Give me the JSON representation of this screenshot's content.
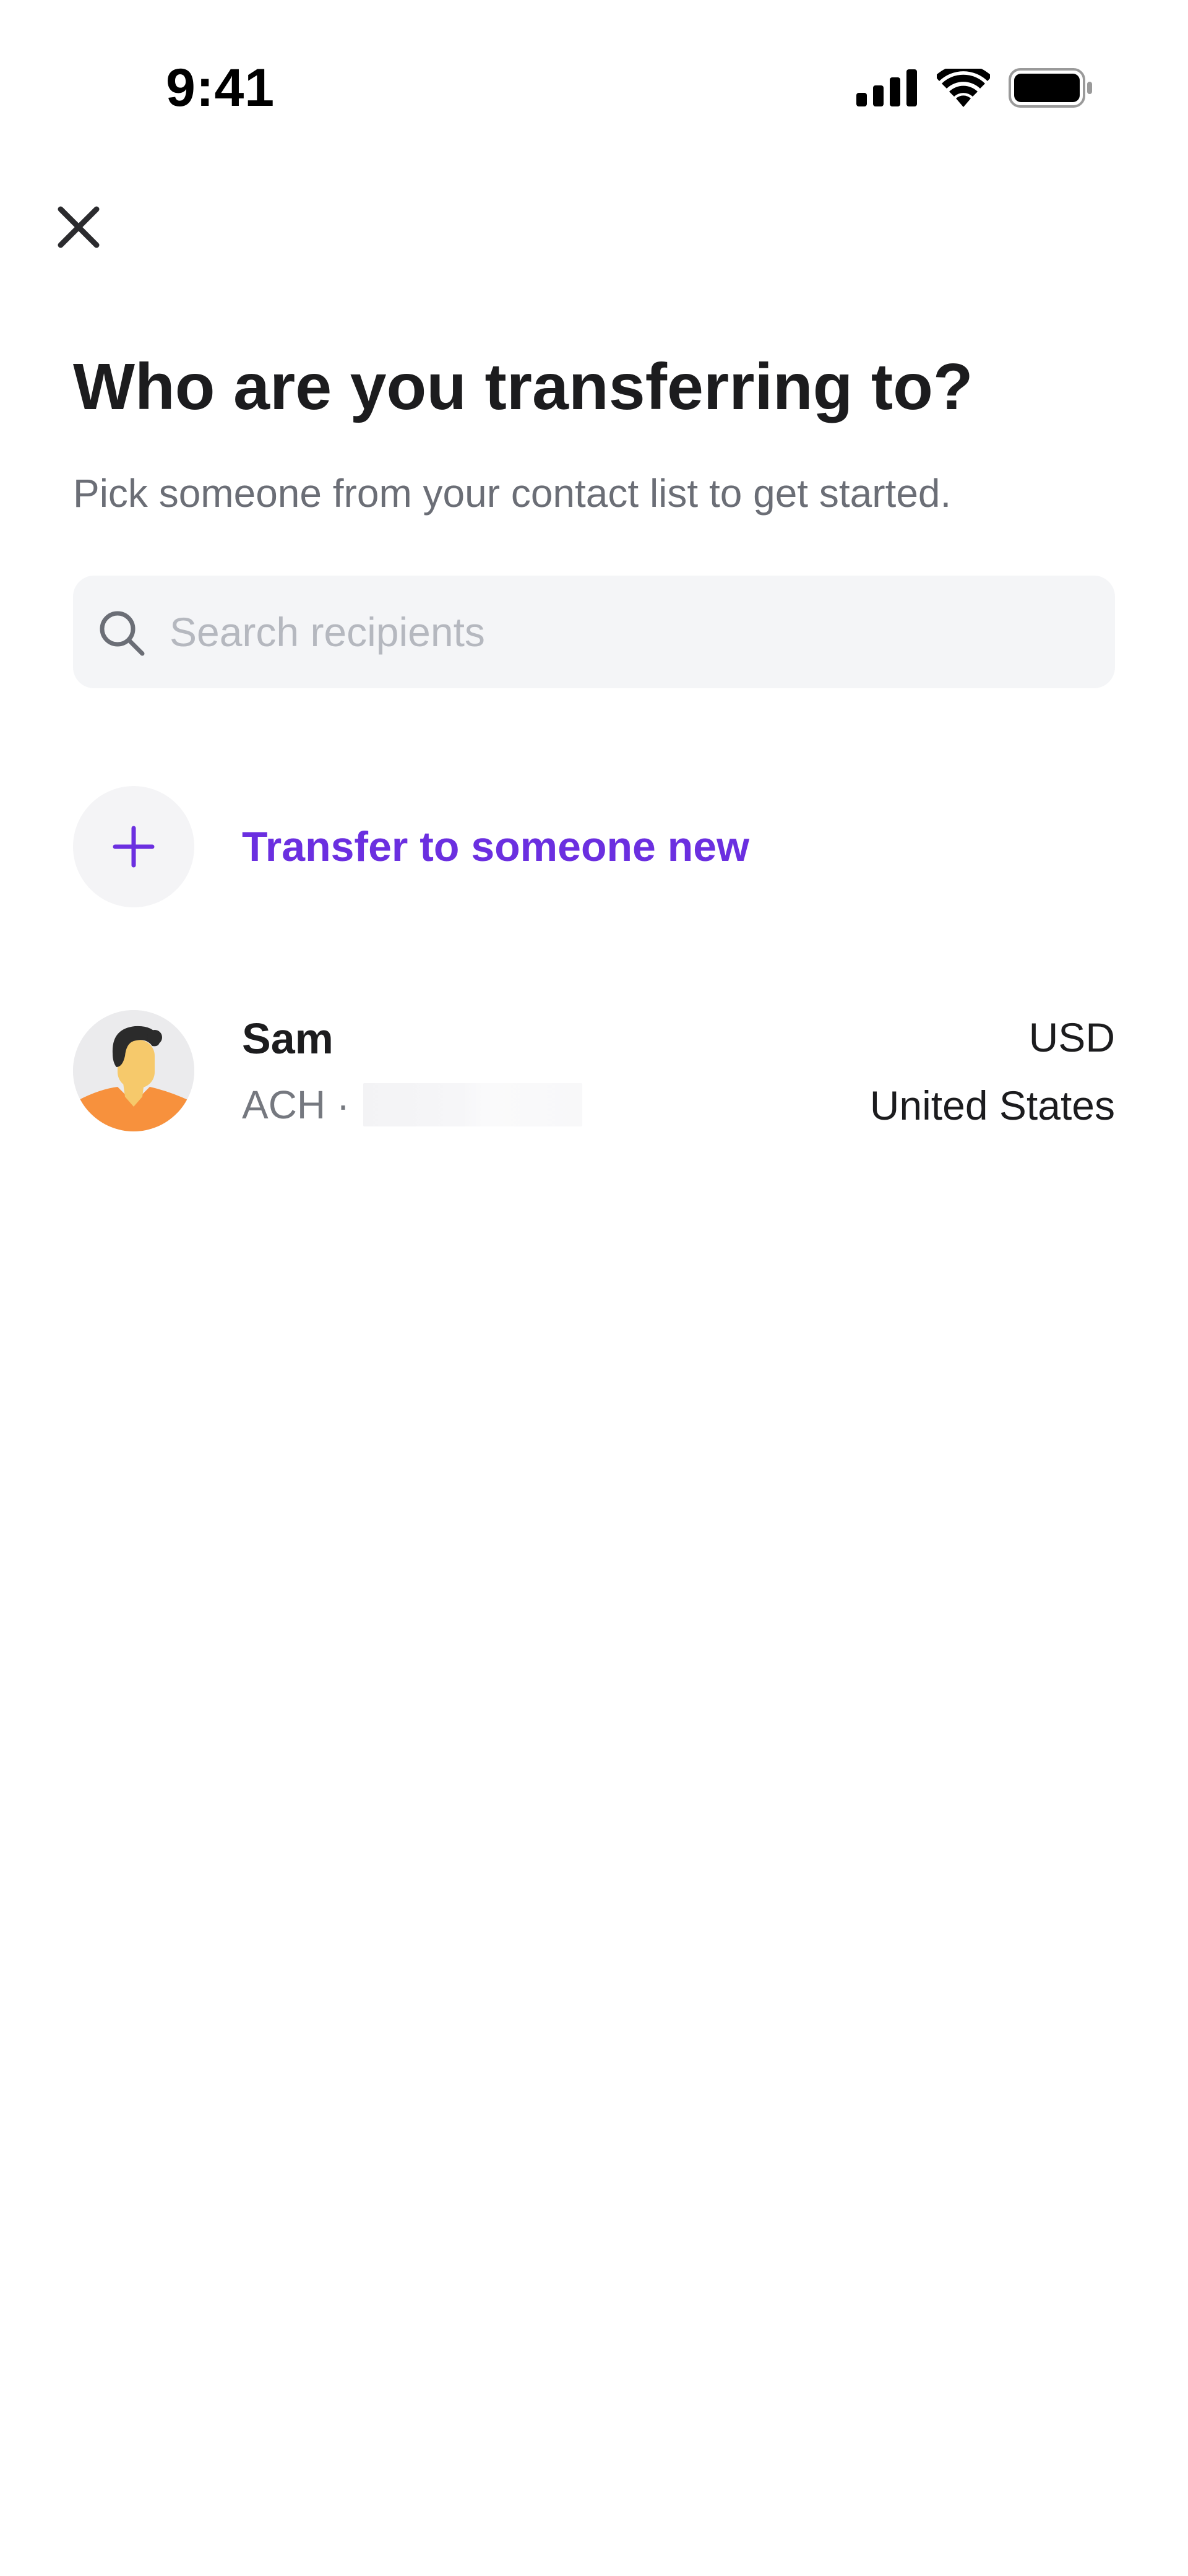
{
  "status_bar": {
    "time": "9:41",
    "icons": [
      "cellular-signal-icon",
      "wifi-icon",
      "battery-icon"
    ]
  },
  "header": {
    "close_icon": "close-icon"
  },
  "main": {
    "title": "Who are you transferring to?",
    "subtitle": "Pick someone from your contact list to get started.",
    "search": {
      "placeholder": "Search recipients",
      "value": "",
      "icon": "search-icon"
    },
    "add_new": {
      "icon": "plus-icon",
      "label": "Transfer to someone new"
    },
    "contacts": [
      {
        "name": "Sam",
        "method": "ACH ·",
        "currency": "USD",
        "country": "United States",
        "avatar_icon": "avatar-illustration"
      }
    ]
  },
  "colors": {
    "accent": "#6b2fe0",
    "title": "#1c1c1e",
    "secondary_text": "#6b6e76",
    "search_background": "#f4f5f7",
    "placeholder": "#b5b8bf",
    "avatar_shirt": "#f7913d",
    "avatar_skin": "#f6c96b",
    "avatar_hair": "#2b2b2b"
  }
}
